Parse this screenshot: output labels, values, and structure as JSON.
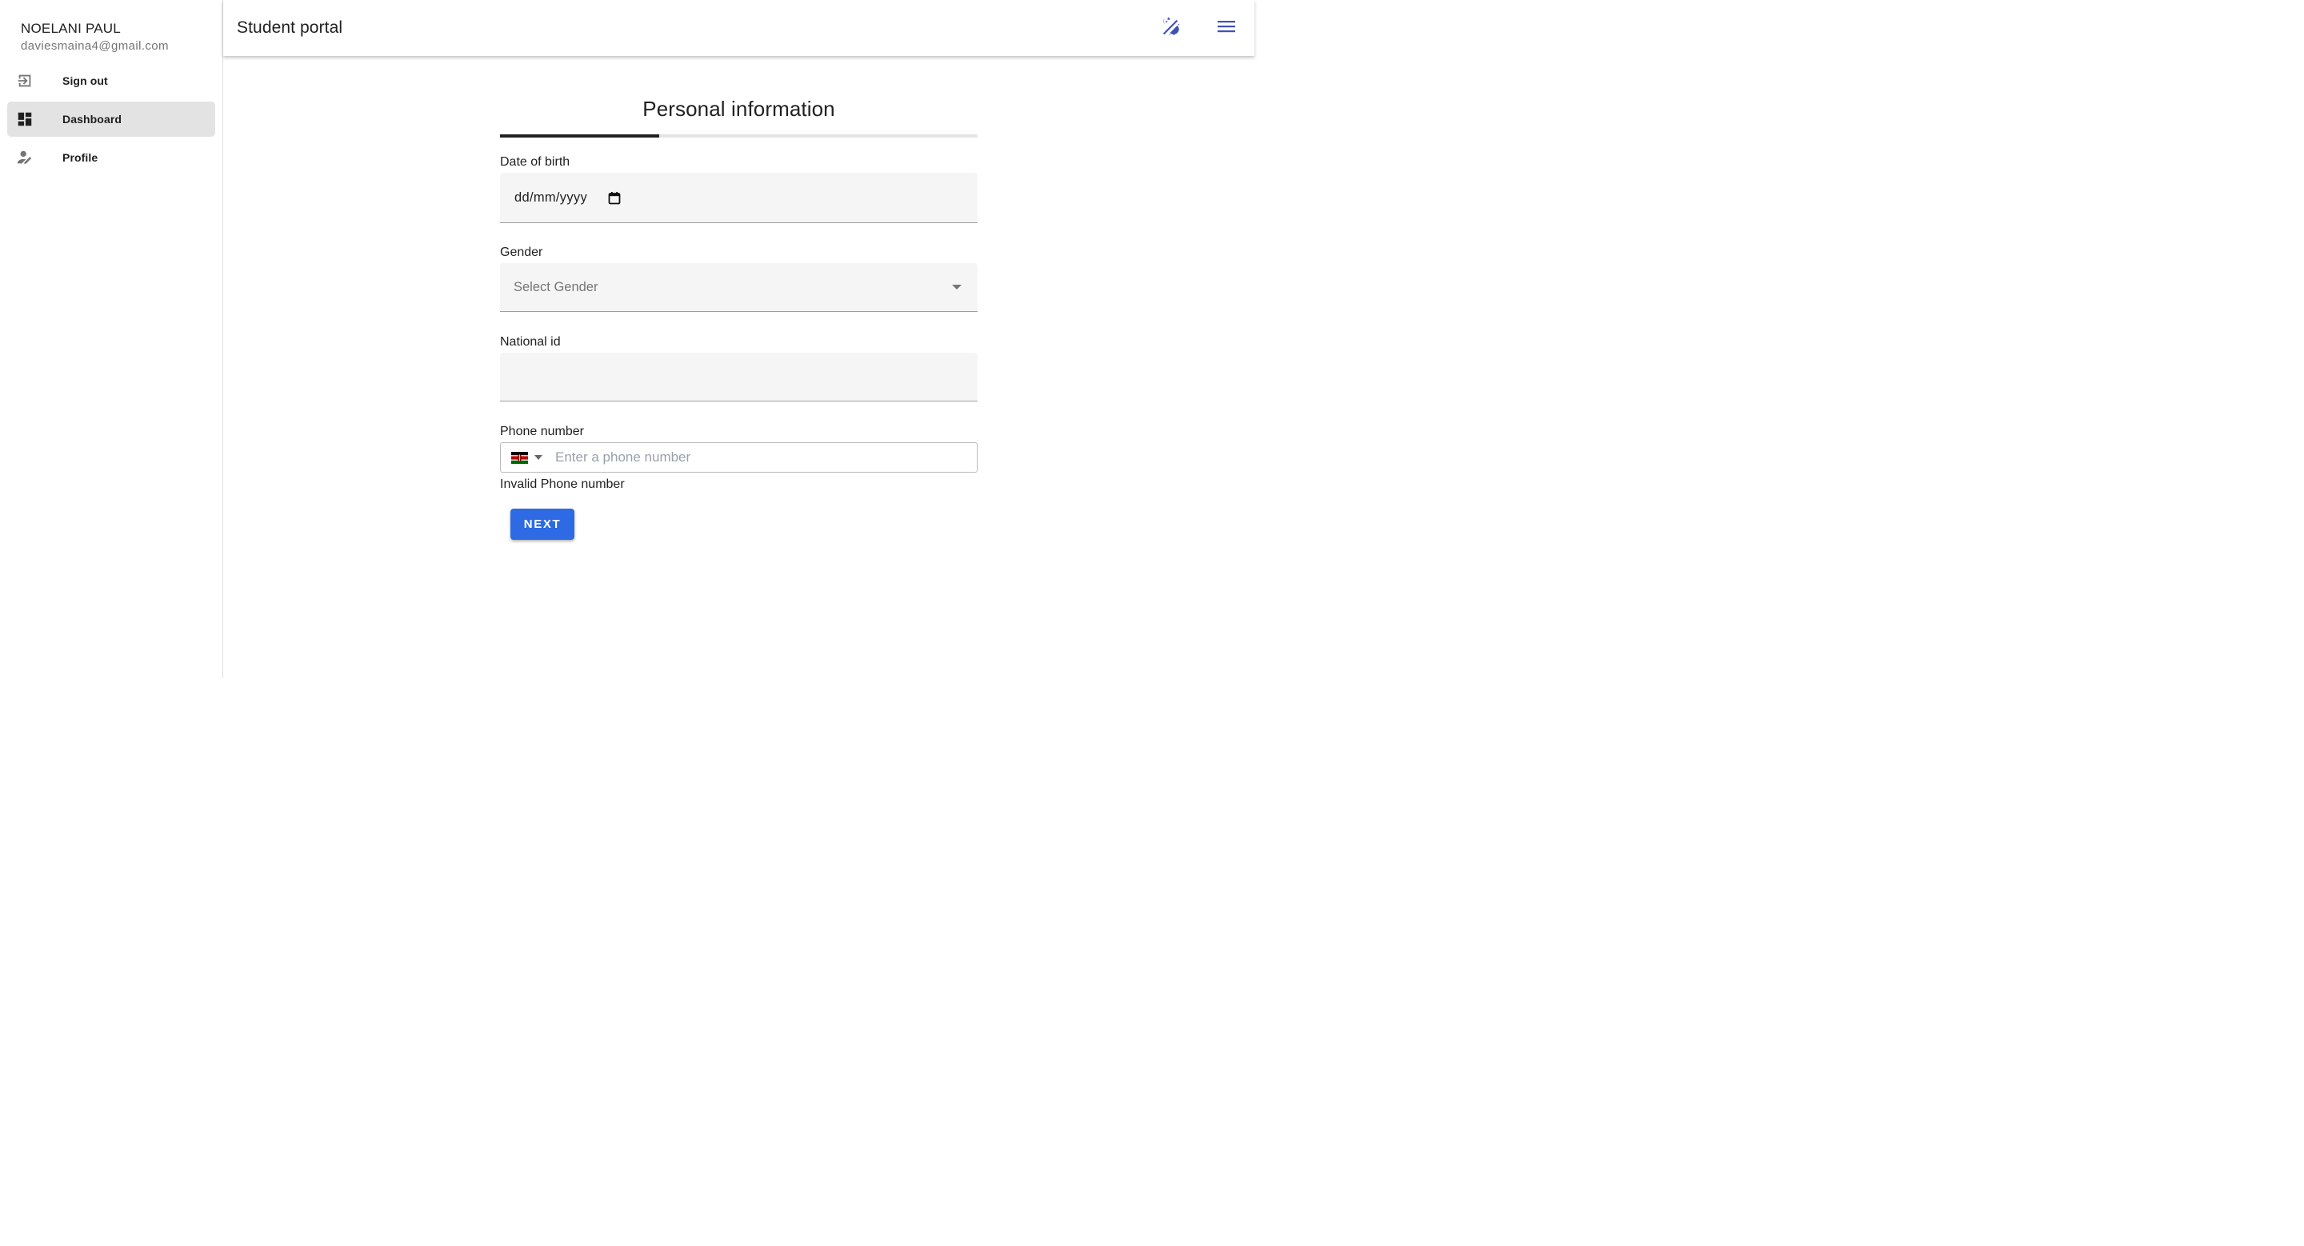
{
  "app": {
    "title": "Student portal",
    "accent_color": "#3f51b5",
    "primary_button_color": "#2d6ae3"
  },
  "header": {
    "title": "Student portal",
    "icons": {
      "theme_toggle": "theme-toggle-icon",
      "menu": "hamburger-menu-icon"
    }
  },
  "sidebar": {
    "user": {
      "name": "NOELANI PAUL",
      "email": "daviesmaina4@gmail.com"
    },
    "items": [
      {
        "label": "Sign out",
        "icon": "sign-out-icon",
        "active": false
      },
      {
        "label": "Dashboard",
        "icon": "dashboard-icon",
        "active": true
      },
      {
        "label": "Profile",
        "icon": "profile-edit-icon",
        "active": false
      }
    ]
  },
  "form": {
    "title": "Personal information",
    "progress": {
      "current_step": 1,
      "total_steps": 3,
      "fraction": 0.333
    },
    "fields": {
      "date_of_birth": {
        "label": "Date of birth",
        "value": "",
        "placeholder": "dd/mm/yyyy"
      },
      "gender": {
        "label": "Gender",
        "selected": "",
        "placeholder": "Select Gender"
      },
      "national_id": {
        "label": "National id",
        "value": "",
        "placeholder": ""
      },
      "phone_number": {
        "label": "Phone number",
        "country": "Kenya",
        "value": "",
        "placeholder": "Enter a phone number",
        "error": "Invalid Phone number"
      }
    },
    "next_label": "NEXT"
  }
}
